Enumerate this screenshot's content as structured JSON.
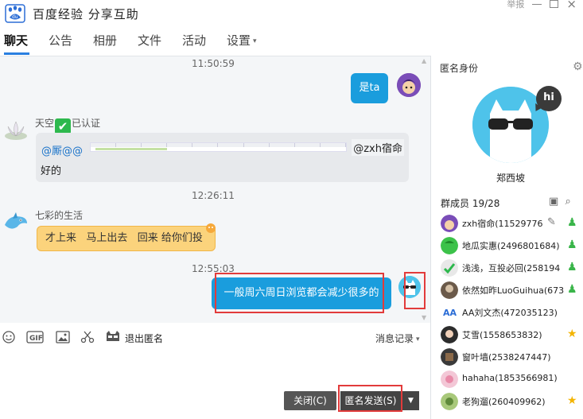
{
  "app": {
    "title": "百度经验  分享互助",
    "report": "举报"
  },
  "tabs": [
    {
      "label": "聊天",
      "active": true
    },
    {
      "label": "公告"
    },
    {
      "label": "相册"
    },
    {
      "label": "文件"
    },
    {
      "label": "活动"
    },
    {
      "label": "设置",
      "has_dropdown": true
    }
  ],
  "chat": {
    "messages": [
      {
        "time": "11:50:59"
      },
      {
        "self": true,
        "text": "是ta"
      },
      {
        "sender": "天空",
        "verified_label": "已认证",
        "mention": "@厮@@",
        "chip": "@zxh宿命",
        "text": "好的"
      },
      {
        "time": "12:26:11"
      },
      {
        "sender": "七彩的生活",
        "text": "才上来   马上出去   回来 给你们投"
      },
      {
        "time": "12:55:03"
      },
      {
        "self": true,
        "text": "一般周六周日浏览都会减少很多的"
      }
    ]
  },
  "toolbar": {
    "exit_anon": "退出匿名",
    "history": "消息记录"
  },
  "buttons": {
    "close": "关闭(C)",
    "anon_send": "匿名发送(S)"
  },
  "side": {
    "title": "匿名身份",
    "anon_name": "郑西坡",
    "members_label": "群成员 19/28",
    "members": [
      {
        "name": "zxh宿命(11529776",
        "badge": "user"
      },
      {
        "name": "地瓜实惠(2496801684)",
        "badge": "user"
      },
      {
        "name": "浅浅，互投必回(258194",
        "badge": "user"
      },
      {
        "name": "依然如昨LuoGuihua(673",
        "badge": "user"
      },
      {
        "name": "AA刘文杰(472035123)",
        "badge": ""
      },
      {
        "name": "艾雪(1558653832)",
        "badge": "star"
      },
      {
        "name": "窗叶墙(2538247447)",
        "badge": ""
      },
      {
        "name": "hahaha(1853566981)",
        "badge": ""
      },
      {
        "name": "老狗遛(260409962)",
        "badge": "star"
      }
    ]
  },
  "colors": {
    "accent": "#1a9ddd",
    "tab_underline": "#2a7fe0",
    "highlight": "#e23b3b"
  }
}
